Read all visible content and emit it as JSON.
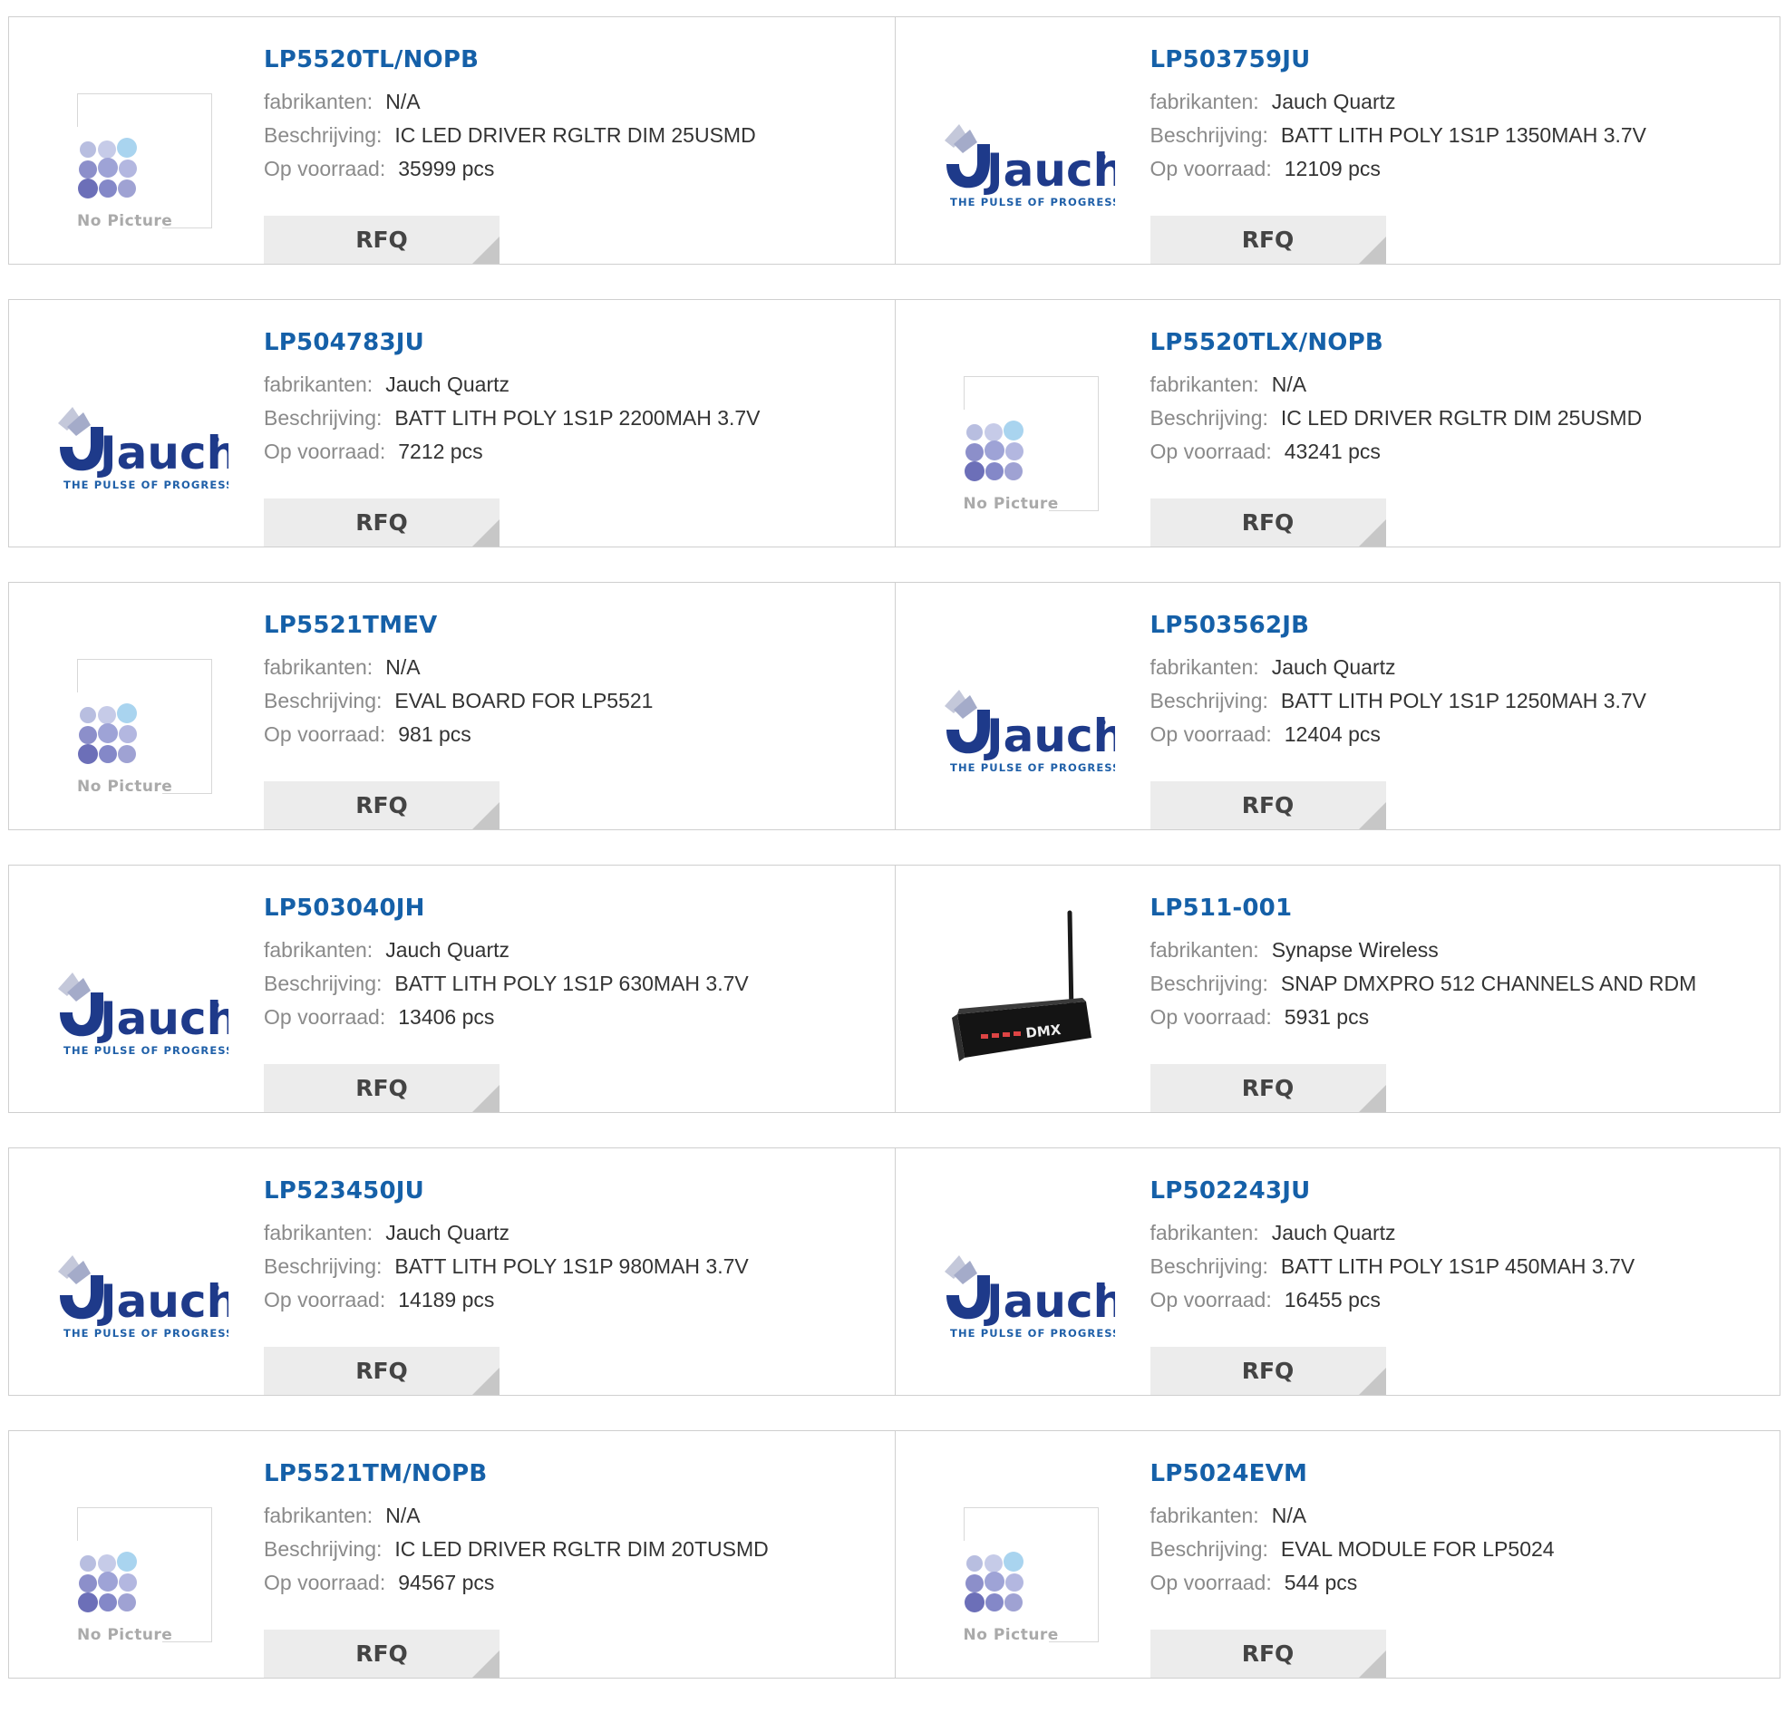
{
  "labels": {
    "manufacturer": "fabrikanten:",
    "description": "Beschrijving:",
    "stock": "Op voorraad:",
    "rfq": "RFQ"
  },
  "brand": {
    "jauch_name": "Jauch",
    "jauch_tagline": "THE PULSE OF PROGRESS",
    "no_picture": "No Picture",
    "device_text": "DMX"
  },
  "colors": {
    "link": "#1560a8",
    "label": "#8a8a8a",
    "value": "#333333",
    "button_bg": "#ececec",
    "border": "#cfcfcf"
  },
  "products": [
    {
      "part": "LP5520TL/NOPB",
      "manufacturer": "N/A",
      "description": "IC LED DRIVER RGLTR DIM 25USMD",
      "stock": "35999 pcs",
      "image": "no-picture"
    },
    {
      "part": "LP503759JU",
      "manufacturer": "Jauch Quartz",
      "description": "BATT LITH POLY 1S1P 1350MAH 3.7V",
      "stock": "12109 pcs",
      "image": "jauch-logo"
    },
    {
      "part": "LP504783JU",
      "manufacturer": "Jauch Quartz",
      "description": "BATT LITH POLY 1S1P 2200MAH 3.7V",
      "stock": "7212 pcs",
      "image": "jauch-logo"
    },
    {
      "part": "LP5520TLX/NOPB",
      "manufacturer": "N/A",
      "description": "IC LED DRIVER RGLTR DIM 25USMD",
      "stock": "43241 pcs",
      "image": "no-picture"
    },
    {
      "part": "LP5521TMEV",
      "manufacturer": "N/A",
      "description": "EVAL BOARD FOR LP5521",
      "stock": "981 pcs",
      "image": "no-picture"
    },
    {
      "part": "LP503562JB",
      "manufacturer": "Jauch Quartz",
      "description": "BATT LITH POLY 1S1P 1250MAH 3.7V",
      "stock": "12404 pcs",
      "image": "jauch-logo"
    },
    {
      "part": "LP503040JH",
      "manufacturer": "Jauch Quartz",
      "description": "BATT LITH POLY 1S1P 630MAH 3.7V",
      "stock": "13406 pcs",
      "image": "jauch-logo"
    },
    {
      "part": "LP511-001",
      "manufacturer": "Synapse Wireless",
      "description": "SNAP DMXPRO 512 CHANNELS AND RDM",
      "stock": "5931 pcs",
      "image": "device-photo"
    },
    {
      "part": "LP523450JU",
      "manufacturer": "Jauch Quartz",
      "description": "BATT LITH POLY 1S1P 980MAH 3.7V",
      "stock": "14189 pcs",
      "image": "jauch-logo"
    },
    {
      "part": "LP502243JU",
      "manufacturer": "Jauch Quartz",
      "description": "BATT LITH POLY 1S1P 450MAH 3.7V",
      "stock": "16455 pcs",
      "image": "jauch-logo"
    },
    {
      "part": "LP5521TM/NOPB",
      "manufacturer": "N/A",
      "description": "IC LED DRIVER RGLTR DIM 20TUSMD",
      "stock": "94567 pcs",
      "image": "no-picture"
    },
    {
      "part": "LP5024EVM",
      "manufacturer": "N/A",
      "description": "EVAL MODULE FOR LP5024",
      "stock": "544 pcs",
      "image": "no-picture"
    }
  ]
}
